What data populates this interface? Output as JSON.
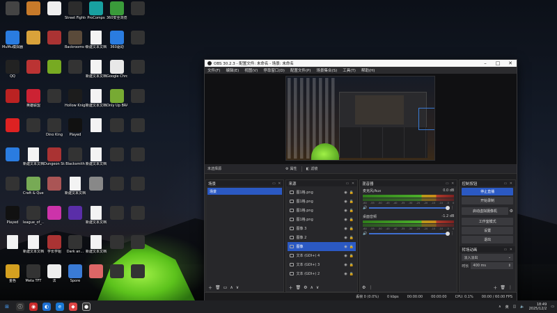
{
  "desktop": {
    "icons": [
      {
        "label": "",
        "color": "#444"
      },
      {
        "label": "",
        "color": "#c77a2a"
      },
      {
        "label": "",
        "color": "#eee"
      },
      {
        "label": "Street Fighter 6",
        "color": "#2c2c2c"
      },
      {
        "label": "ProComps",
        "color": "#18a0a0"
      },
      {
        "label": "360安全浏览器",
        "color": "#3a9b3a"
      },
      {
        "label": "",
        "color": "#333"
      },
      {
        "label": "MuMu模拟器",
        "color": "#2a7ce0"
      },
      {
        "label": "",
        "color": "#d9a23a"
      },
      {
        "label": "",
        "color": "#aa3333"
      },
      {
        "label": "Backrooms Company",
        "color": "#5a4a3a"
      },
      {
        "label": "新建文本文档",
        "color": "#f3f3f3"
      },
      {
        "label": "360驱动",
        "color": "#2a7ce0"
      },
      {
        "label": "",
        "color": "#333"
      },
      {
        "label": "QQ",
        "color": "#222"
      },
      {
        "label": "",
        "color": "#b33"
      },
      {
        "label": "",
        "color": "#7a2"
      },
      {
        "label": "",
        "color": "#333"
      },
      {
        "label": "新建文本文档",
        "color": "#f3f3f3"
      },
      {
        "label": "Google Chrome",
        "color": "#e8e8e8"
      },
      {
        "label": "",
        "color": "#333"
      },
      {
        "label": "",
        "color": "#b22"
      },
      {
        "label": "英雄联盟",
        "color": "#c23"
      },
      {
        "label": "",
        "color": "#333"
      },
      {
        "label": "Hollow Knight",
        "color": "#1c1c1c"
      },
      {
        "label": "新建文本文档",
        "color": "#f3f3f3"
      },
      {
        "label": "Only Up BRAINROT",
        "color": "#7a3"
      },
      {
        "label": "",
        "color": "#333"
      },
      {
        "label": "",
        "color": "#d22"
      },
      {
        "label": "",
        "color": "#333"
      },
      {
        "label": "Dino King",
        "color": "#333"
      },
      {
        "label": "Played",
        "color": "#111"
      },
      {
        "label": "",
        "color": "#f3f3f3"
      },
      {
        "label": "",
        "color": "#333"
      },
      {
        "label": "",
        "color": "#333"
      },
      {
        "label": "",
        "color": "#2a7ce0"
      },
      {
        "label": "新建文本文档",
        "color": "#f3f3f3"
      },
      {
        "label": "Dungeon Stalkers",
        "color": "#a33"
      },
      {
        "label": "Blacksmith",
        "color": "#333"
      },
      {
        "label": "新建文本文档",
        "color": "#f3f3f3"
      },
      {
        "label": "",
        "color": "#333"
      },
      {
        "label": "",
        "color": "#333"
      },
      {
        "label": "",
        "color": "#333"
      },
      {
        "label": "Craft & Quests",
        "color": "#7a5"
      },
      {
        "label": "",
        "color": "#a55"
      },
      {
        "label": "新建文本文档",
        "color": "#f3f3f3"
      },
      {
        "label": "",
        "color": "#888"
      },
      {
        "label": "",
        "color": "#333"
      },
      {
        "label": "",
        "color": "#333"
      },
      {
        "label": "Played",
        "color": "#111"
      },
      {
        "label": "league_of_...",
        "color": "#333"
      },
      {
        "label": "",
        "color": "#c3a"
      },
      {
        "label": "",
        "color": "#5a2ea8"
      },
      {
        "label": "新建文本文档",
        "color": "#f3f3f3"
      },
      {
        "label": "",
        "color": "#333"
      },
      {
        "label": "",
        "color": "#333"
      },
      {
        "label": "",
        "color": "#f3f3f3"
      },
      {
        "label": "新建文本文档",
        "color": "#f3f3f3"
      },
      {
        "label": "学长学姐",
        "color": "#a33"
      },
      {
        "label": "Dark an...",
        "color": "#333"
      },
      {
        "label": "新建文本文档",
        "color": "#f3f3f3"
      },
      {
        "label": "",
        "color": "#333"
      },
      {
        "label": "",
        "color": "#333"
      },
      {
        "label": "金色",
        "color": "#d4a020"
      },
      {
        "label": "Meta TFT",
        "color": "#333"
      },
      {
        "label": "法",
        "color": "#eee"
      },
      {
        "label": "Spore",
        "color": "#3a7bd5"
      },
      {
        "label": "",
        "color": "#d66"
      },
      {
        "label": "",
        "color": "#333"
      },
      {
        "label": "",
        "color": "#333"
      }
    ]
  },
  "obs": {
    "title": "OBS 30.2.3 - 配置文件: 未命名 - 场景: 未命名",
    "menu": [
      "文件(F)",
      "编辑(E)",
      "视图(V)",
      "停靠窗口(D)",
      "配置文件(P)",
      "场景集合(S)",
      "工具(T)",
      "帮助(H)"
    ],
    "scene_bar": {
      "current": "未选择源",
      "properties": "属性",
      "filters": "滤镜"
    },
    "scenes": {
      "title": "场景",
      "items": [
        "场景"
      ]
    },
    "sources": {
      "title": "来源",
      "items": [
        {
          "name": "图1格.png",
          "selected": false
        },
        {
          "name": "图1格.png",
          "selected": false
        },
        {
          "name": "图1格.png",
          "selected": false
        },
        {
          "name": "图1格.png",
          "selected": false
        },
        {
          "name": "图像 3",
          "selected": false
        },
        {
          "name": "图像 2",
          "selected": false
        },
        {
          "name": "图像",
          "selected": true
        },
        {
          "name": "文本 (GDI+) 4",
          "selected": false
        },
        {
          "name": "文本 (GDI+) 3",
          "selected": false
        },
        {
          "name": "文本 (GDI+) 2",
          "selected": false
        }
      ]
    },
    "mixer": {
      "title": "混音器",
      "channels": [
        {
          "name": "麦克风/Aux",
          "db": "0.0 dB"
        },
        {
          "name": "桌面音频",
          "db": "-1.2 dB"
        }
      ],
      "ticks": [
        "-60",
        "-55",
        "-50",
        "-45",
        "-40",
        "-35",
        "-30",
        "-25",
        "-20",
        "-15",
        "-10",
        "-5",
        "0"
      ]
    },
    "controls": {
      "title": "控制按钮",
      "start_stream": "停止直播",
      "start_record": "开始录制",
      "virtual_cam": "启动虚拟摄像机",
      "studio_mode": "工作室模式",
      "settings": "设置",
      "exit": "退出"
    },
    "transitions": {
      "title": "转场动画",
      "selected": "淡入淡出",
      "duration_label": "时长",
      "duration": "400 ms"
    },
    "status": {
      "dropped": "丢帧 0 (0.0%)",
      "bitrate": "0 kbps",
      "stream_time": "00:00:00",
      "rec_time": "00:00:00",
      "cpu": "CPU: 0.1%",
      "fps": "00:00 / 60.00 FPS"
    }
  },
  "taskbar": {
    "lang": "英",
    "time": "18:49",
    "date": "2025/12/2"
  }
}
